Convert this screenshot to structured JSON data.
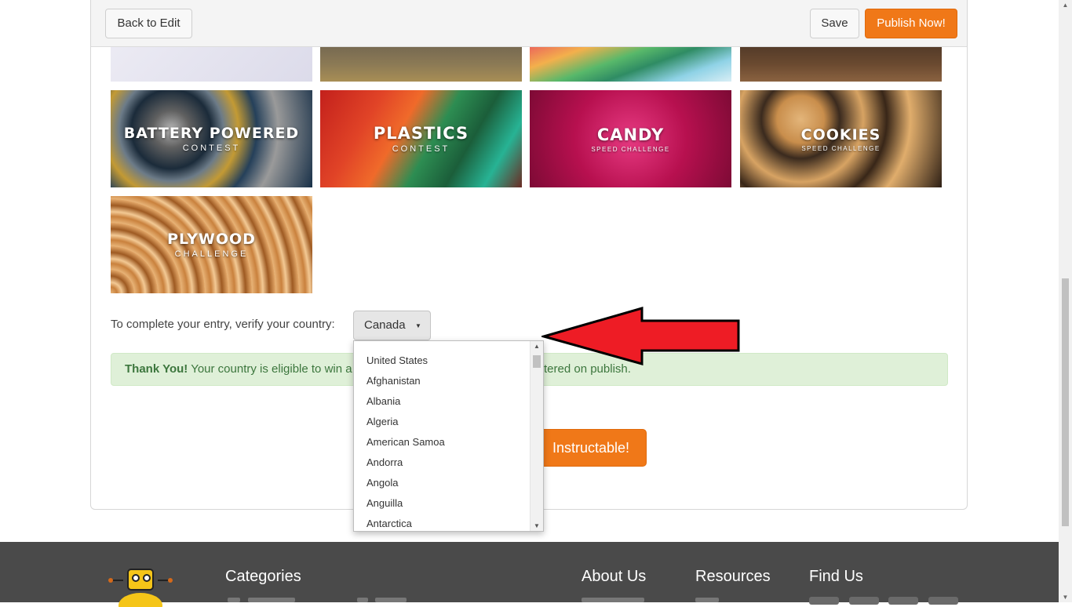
{
  "toolbar": {
    "back_label": "Back to Edit",
    "save_label": "Save",
    "publish_label": "Publish Now!"
  },
  "tiles": [
    {
      "title": "BATTERY POWERED",
      "subtitle": "CONTEST"
    },
    {
      "title": "PLASTICS",
      "subtitle": "CONTEST"
    },
    {
      "title": "CANDY",
      "subtitle": "SPEED CHALLENGE"
    },
    {
      "title": "COOKIES",
      "subtitle": "SPEED CHALLENGE"
    },
    {
      "title": "PLYWOOD",
      "subtitle": "CHALLENGE"
    }
  ],
  "country": {
    "label": "To complete your entry, verify your country:",
    "selected": "Canada",
    "options": [
      "United States",
      "Afghanistan",
      "Albania",
      "Algeria",
      "American Samoa",
      "Andorra",
      "Angola",
      "Anguilla",
      "Antarctica"
    ]
  },
  "alert": {
    "strong": "Thank You!",
    "text_visible_left": "Your country is eligible to win a",
    "text_visible_right": "tered on publish."
  },
  "publish_big_label": "Instructable!",
  "footer": {
    "categories": "Categories",
    "about": "About Us",
    "resources": "Resources",
    "find_us": "Find Us"
  },
  "colors": {
    "accent_orange": "#f07818",
    "alert_green_bg": "#dff0d8",
    "alert_green_text": "#3c763d",
    "arrow_red": "#ee1c25",
    "footer_bg": "#4a4a4a"
  }
}
